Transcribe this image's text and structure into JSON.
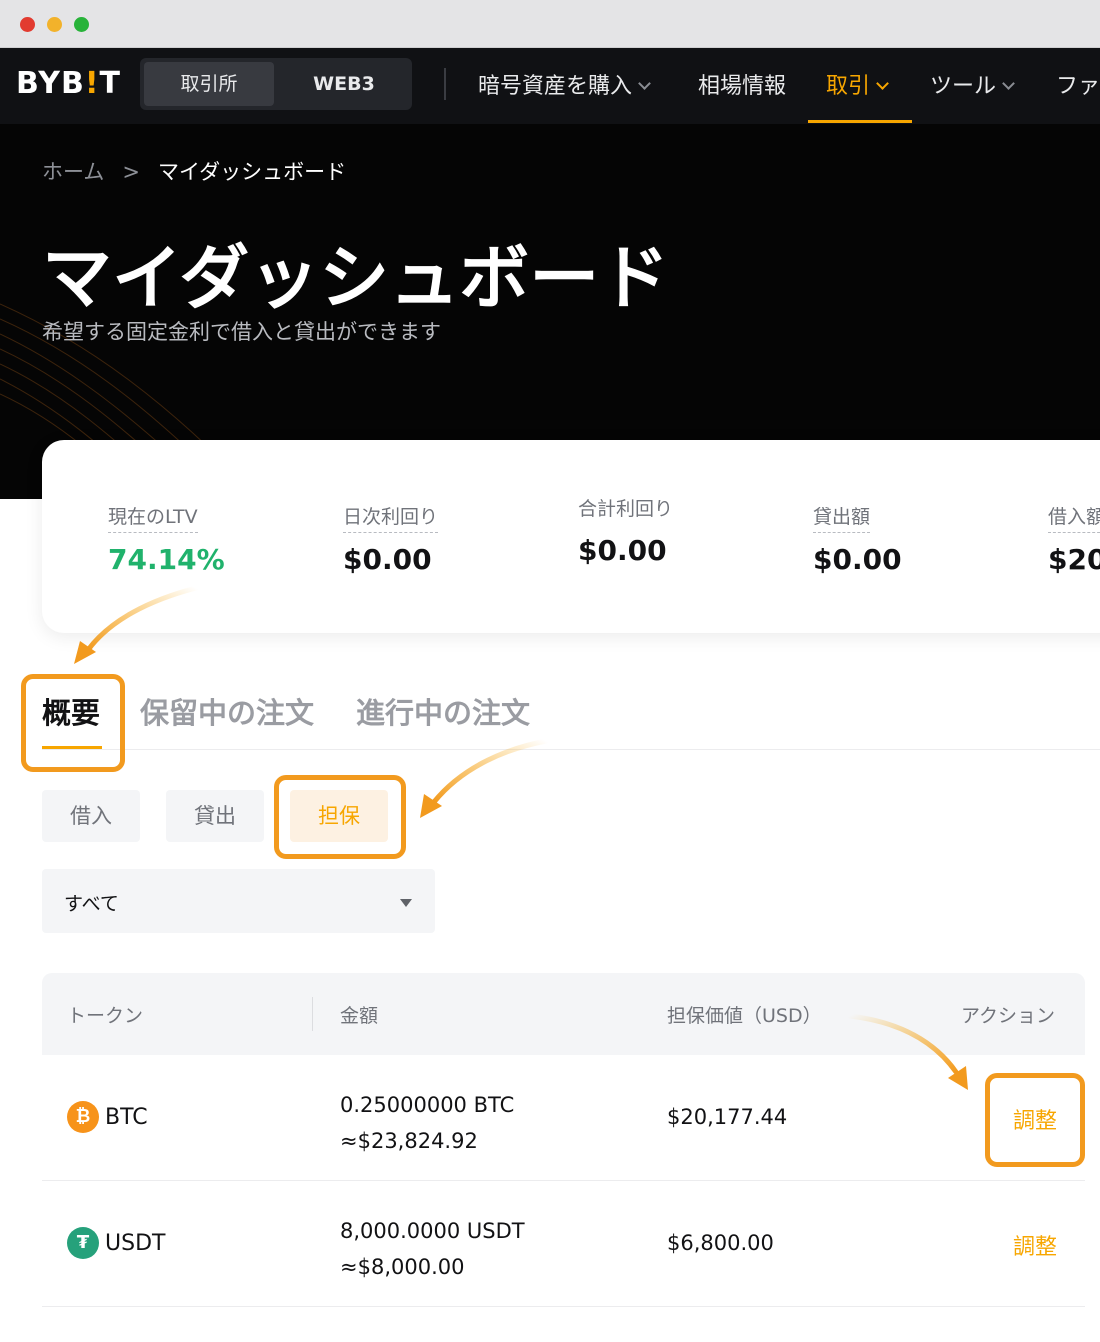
{
  "brand": {
    "logo_prefix": "BYB",
    "logo_bang": "!",
    "logo_suffix": "T"
  },
  "segment": {
    "exchange": "取引所",
    "web3": "WEB3"
  },
  "nav": {
    "items": [
      {
        "label": "暗号資産を購入",
        "has_dropdown": true
      },
      {
        "label": "相場情報",
        "has_dropdown": false
      },
      {
        "label": "取引",
        "has_dropdown": true,
        "active": true
      },
      {
        "label": "ツール",
        "has_dropdown": true
      },
      {
        "label": "ファ",
        "has_dropdown": false
      }
    ]
  },
  "breadcrumb": {
    "home": "ホーム",
    "separator": ">",
    "current": "マイダッシュボード"
  },
  "hero": {
    "title": "マイダッシュボード",
    "subtitle": "希望する固定金利で借入と貸出ができます"
  },
  "stats": [
    {
      "label": "現在のLTV",
      "value": "74.14%"
    },
    {
      "label": "日次利回り",
      "value": "$0.00"
    },
    {
      "label": "合計利回り",
      "value": "$0.00"
    },
    {
      "label": "貸出額",
      "value": "$0.00"
    },
    {
      "label": "借入額",
      "value": "$20"
    }
  ],
  "tabs": {
    "overview": "概要",
    "pending": "保留中の注文",
    "active": "進行中の注文"
  },
  "subtabs": {
    "borrow": "借入",
    "lend": "貸出",
    "collateral": "担保"
  },
  "filter": {
    "selected": "すべて"
  },
  "table": {
    "headers": {
      "token": "トークン",
      "amount": "金額",
      "collateral_value": "担保価値（USD）",
      "action": "アクション"
    },
    "rows": [
      {
        "token": "BTC",
        "icon": "₿",
        "amount": "0.25000000 BTC",
        "amount_usd": "≈$23,824.92",
        "collateral_value": "$20,177.44",
        "action": "調整"
      },
      {
        "token": "USDT",
        "icon": "₮",
        "amount": "8,000.0000 USDT",
        "amount_usd": "≈$8,000.00",
        "collateral_value": "$6,800.00",
        "action": "調整"
      }
    ]
  },
  "colors": {
    "accent": "#f7a600",
    "highlight": "#f29a1e",
    "positive": "#20b26c",
    "hero_bg": "#050505",
    "nav_bg": "#101114"
  }
}
